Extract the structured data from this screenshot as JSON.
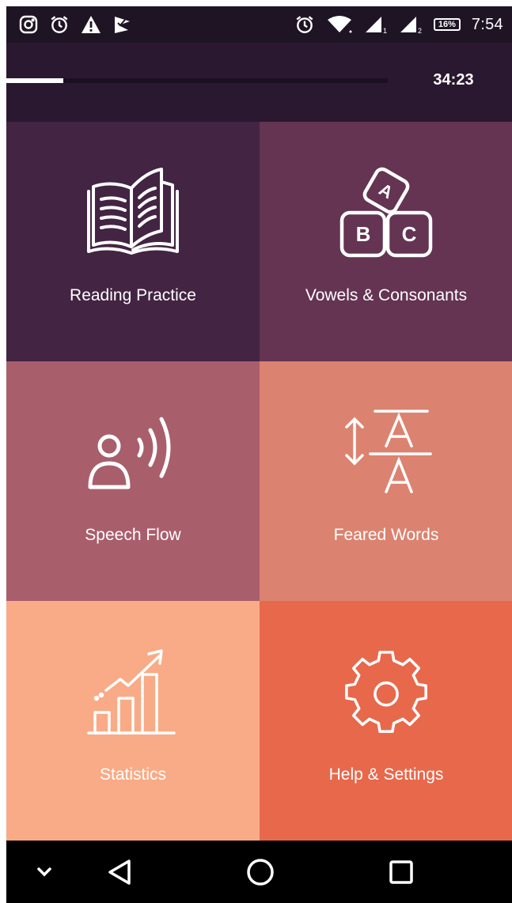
{
  "status_bar": {
    "left_icons": [
      "instagram-icon",
      "alarm-icon",
      "warning-icon",
      "check-flag-icon"
    ],
    "right_icons": [
      "alarm-icon",
      "wifi-icon",
      "signal-sim1-icon",
      "signal-sim2-icon"
    ],
    "battery": "16%",
    "time": "7:54"
  },
  "header": {
    "progress": 0.15,
    "timer": "34:23"
  },
  "tiles": [
    {
      "label": "Reading Practice",
      "icon": "open-book-icon",
      "color": "#432443"
    },
    {
      "label": "Vowels & Consonants",
      "icon": "abc-blocks-icon",
      "color": "#643452"
    },
    {
      "label": "Speech Flow",
      "icon": "speaking-person-icon",
      "color": "#a95e6c"
    },
    {
      "label": "Feared Words",
      "icon": "text-size-icon",
      "color": "#db8370"
    },
    {
      "label": "Statistics",
      "icon": "bar-chart-growth-icon",
      "color": "#f8ab86"
    },
    {
      "label": "Help & Settings",
      "icon": "gear-icon",
      "color": "#e8684b"
    }
  ],
  "nav_bar": {
    "buttons": [
      "chevron-down-icon",
      "back-icon",
      "home-icon",
      "recents-icon"
    ]
  }
}
